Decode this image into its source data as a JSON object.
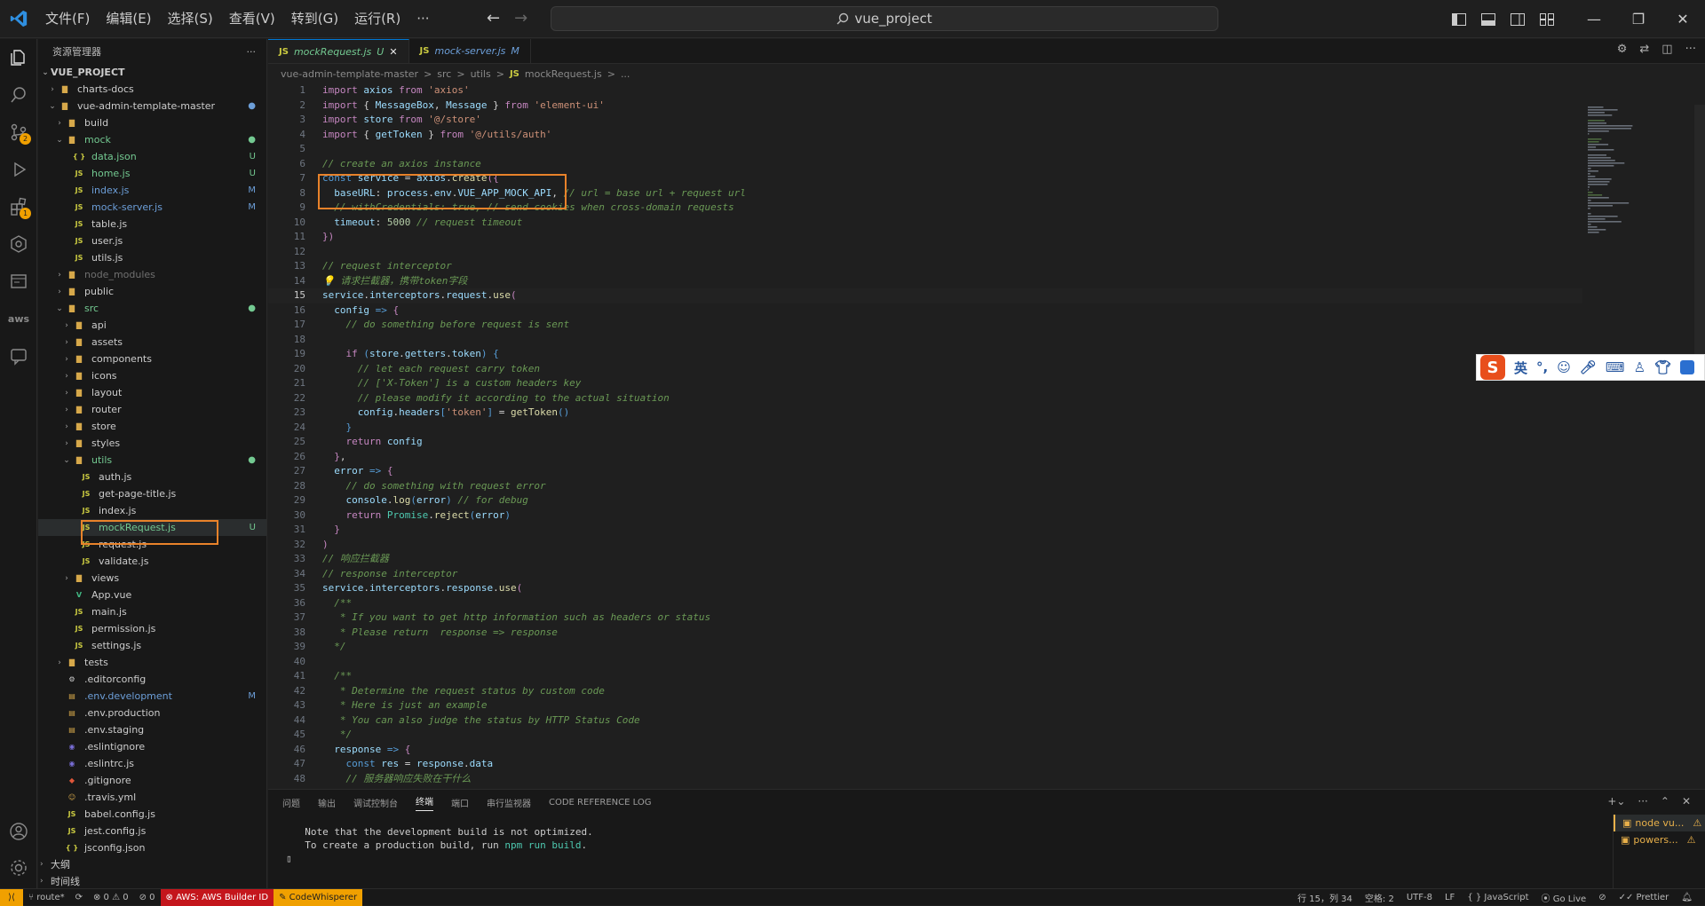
{
  "titlebar": {
    "menu": [
      "文件(F)",
      "编辑(E)",
      "选择(S)",
      "查看(V)",
      "转到(G)",
      "运行(R)",
      "···"
    ],
    "search_text": "vue_project"
  },
  "sidebar": {
    "header": "资源管理器",
    "project": "VUE_PROJECT",
    "outline": "大纲",
    "timeline": "时间线"
  },
  "tree": [
    {
      "name": "charts-docs",
      "indent": 1,
      "type": "folder",
      "open": false
    },
    {
      "name": "vue-admin-template-master",
      "indent": 1,
      "type": "folder",
      "open": true,
      "status": "●",
      "statusClass": "cM"
    },
    {
      "name": "build",
      "indent": 2,
      "type": "folder",
      "open": false
    },
    {
      "name": "mock",
      "indent": 2,
      "type": "folder",
      "open": true,
      "status": "●",
      "statusClass": "cU",
      "textClass": "cU"
    },
    {
      "name": "data.json",
      "indent": 3,
      "type": "json",
      "status": "U",
      "statusClass": "cU",
      "textClass": "cU"
    },
    {
      "name": "home.js",
      "indent": 3,
      "type": "js",
      "status": "U",
      "statusClass": "cU",
      "textClass": "cU"
    },
    {
      "name": "index.js",
      "indent": 3,
      "type": "js",
      "status": "M",
      "statusClass": "cM",
      "textClass": "cM"
    },
    {
      "name": "mock-server.js",
      "indent": 3,
      "type": "js",
      "status": "M",
      "statusClass": "cM",
      "textClass": "cM"
    },
    {
      "name": "table.js",
      "indent": 3,
      "type": "js"
    },
    {
      "name": "user.js",
      "indent": 3,
      "type": "js"
    },
    {
      "name": "utils.js",
      "indent": 3,
      "type": "js"
    },
    {
      "name": "node_modules",
      "indent": 2,
      "type": "folder",
      "open": false,
      "textClass": "cG"
    },
    {
      "name": "public",
      "indent": 2,
      "type": "folder",
      "open": false
    },
    {
      "name": "src",
      "indent": 2,
      "type": "folder",
      "open": true,
      "status": "●",
      "statusClass": "cU",
      "textClass": "cU"
    },
    {
      "name": "api",
      "indent": 3,
      "type": "folder",
      "open": false
    },
    {
      "name": "assets",
      "indent": 3,
      "type": "folder",
      "open": false
    },
    {
      "name": "components",
      "indent": 3,
      "type": "folder",
      "open": false
    },
    {
      "name": "icons",
      "indent": 3,
      "type": "folder",
      "open": false
    },
    {
      "name": "layout",
      "indent": 3,
      "type": "folder",
      "open": false
    },
    {
      "name": "router",
      "indent": 3,
      "type": "folder",
      "open": false
    },
    {
      "name": "store",
      "indent": 3,
      "type": "folder",
      "open": false
    },
    {
      "name": "styles",
      "indent": 3,
      "type": "folder",
      "open": false
    },
    {
      "name": "utils",
      "indent": 3,
      "type": "folder",
      "open": true,
      "status": "●",
      "statusClass": "cU",
      "textClass": "cU"
    },
    {
      "name": "auth.js",
      "indent": 4,
      "type": "js"
    },
    {
      "name": "get-page-title.js",
      "indent": 4,
      "type": "js"
    },
    {
      "name": "index.js",
      "indent": 4,
      "type": "js"
    },
    {
      "name": "mockRequest.js",
      "indent": 4,
      "type": "js",
      "status": "U",
      "statusClass": "cU",
      "textClass": "cU",
      "selected": true
    },
    {
      "name": "request.js",
      "indent": 4,
      "type": "js"
    },
    {
      "name": "validate.js",
      "indent": 4,
      "type": "js"
    },
    {
      "name": "views",
      "indent": 3,
      "type": "folder",
      "open": false
    },
    {
      "name": "App.vue",
      "indent": 3,
      "type": "vue"
    },
    {
      "name": "main.js",
      "indent": 3,
      "type": "js"
    },
    {
      "name": "permission.js",
      "indent": 3,
      "type": "js"
    },
    {
      "name": "settings.js",
      "indent": 3,
      "type": "js"
    },
    {
      "name": "tests",
      "indent": 2,
      "type": "folder",
      "open": false
    },
    {
      "name": ".editorconfig",
      "indent": 2,
      "type": "cfg"
    },
    {
      "name": ".env.development",
      "indent": 2,
      "type": "env",
      "status": "M",
      "statusClass": "cM",
      "textClass": "cM"
    },
    {
      "name": ".env.production",
      "indent": 2,
      "type": "env"
    },
    {
      "name": ".env.staging",
      "indent": 2,
      "type": "env"
    },
    {
      "name": ".eslintignore",
      "indent": 2,
      "type": "eslint"
    },
    {
      "name": ".eslintrc.js",
      "indent": 2,
      "type": "eslint"
    },
    {
      "name": ".gitignore",
      "indent": 2,
      "type": "git"
    },
    {
      "name": ".travis.yml",
      "indent": 2,
      "type": "travis"
    },
    {
      "name": "babel.config.js",
      "indent": 2,
      "type": "js"
    },
    {
      "name": "jest.config.js",
      "indent": 2,
      "type": "js"
    },
    {
      "name": "jsconfig.json",
      "indent": 2,
      "type": "json"
    }
  ],
  "tabs": [
    {
      "label": "mockRequest.js",
      "status": "U",
      "active": true
    },
    {
      "label": "mock-server.js",
      "status": "M",
      "active": false
    }
  ],
  "breadcrumb": [
    "vue-admin-template-master",
    ">",
    "src",
    ">",
    "utils",
    ">",
    "JS",
    "mockRequest.js",
    ">",
    "..."
  ],
  "code": [
    [
      [
        "kw",
        "import "
      ],
      [
        "vr",
        "axios "
      ],
      [
        "kw",
        "from "
      ],
      [
        "st2",
        "'axios'"
      ]
    ],
    [
      [
        "kw",
        "import "
      ],
      [
        "df",
        "{ "
      ],
      [
        "vr",
        "MessageBox"
      ],
      [
        "df",
        ", "
      ],
      [
        "vr",
        "Message "
      ],
      [
        "df",
        "} "
      ],
      [
        "kw",
        "from "
      ],
      [
        "st2",
        "'element-ui'"
      ]
    ],
    [
      [
        "kw",
        "import "
      ],
      [
        "vr",
        "store "
      ],
      [
        "kw",
        "from "
      ],
      [
        "st2",
        "'@/store'"
      ]
    ],
    [
      [
        "kw",
        "import "
      ],
      [
        "df",
        "{ "
      ],
      [
        "vr",
        "getToken "
      ],
      [
        "df",
        "} "
      ],
      [
        "kw",
        "from "
      ],
      [
        "st2",
        "'@/utils/auth'"
      ]
    ],
    [],
    [
      [
        "cm",
        "// create an axios instance"
      ]
    ],
    [
      [
        "bl",
        "const "
      ],
      [
        "vr",
        "service "
      ],
      [
        "df",
        "= "
      ],
      [
        "vr",
        "axios"
      ],
      [
        "df",
        "."
      ],
      [
        "fn",
        "create"
      ],
      [
        "kw",
        "({"
      ]
    ],
    [
      [
        "df",
        "  "
      ],
      [
        "vr",
        "baseURL"
      ],
      [
        "df",
        ": "
      ],
      [
        "vr",
        "process"
      ],
      [
        "df",
        "."
      ],
      [
        "vr",
        "env"
      ],
      [
        "df",
        "."
      ],
      [
        "vr",
        "VUE_APP_MOCK_API"
      ],
      [
        "df",
        ", "
      ],
      [
        "cm",
        "// url = base url + request url"
      ]
    ],
    [
      [
        "df",
        "  "
      ],
      [
        "cm",
        "// withCredentials: true, // send cookies when cross-domain requests"
      ]
    ],
    [
      [
        "df",
        "  "
      ],
      [
        "vr",
        "timeout"
      ],
      [
        "df",
        ": "
      ],
      [
        "nm",
        "5000 "
      ],
      [
        "cm",
        "// request timeout"
      ]
    ],
    [
      [
        "kw",
        "})"
      ]
    ],
    [],
    [
      [
        "cm",
        "// request interceptor"
      ]
    ],
    [
      [
        "cm",
        "💡 请求拦截器，携带token字段"
      ]
    ],
    [
      [
        "vr",
        "service"
      ],
      [
        "df",
        "."
      ],
      [
        "vr",
        "interceptors"
      ],
      [
        "df",
        "."
      ],
      [
        "vr",
        "request"
      ],
      [
        "df",
        "."
      ],
      [
        "fn",
        "use"
      ],
      [
        "kw",
        "("
      ]
    ],
    [
      [
        "df",
        "  "
      ],
      [
        "vr",
        "config "
      ],
      [
        "bl",
        "=> "
      ],
      [
        "kw",
        "{"
      ]
    ],
    [
      [
        "df",
        "    "
      ],
      [
        "cm",
        "// do something before request is sent"
      ]
    ],
    [],
    [
      [
        "df",
        "    "
      ],
      [
        "kw",
        "if "
      ],
      [
        "bl",
        "("
      ],
      [
        "vr",
        "store"
      ],
      [
        "df",
        "."
      ],
      [
        "vr",
        "getters"
      ],
      [
        "df",
        "."
      ],
      [
        "vr",
        "token"
      ],
      [
        "bl",
        ") "
      ],
      [
        "bl",
        "{"
      ]
    ],
    [
      [
        "df",
        "      "
      ],
      [
        "cm",
        "// let each request carry token"
      ]
    ],
    [
      [
        "df",
        "      "
      ],
      [
        "cm",
        "// ['X-Token'] is a custom headers key"
      ]
    ],
    [
      [
        "df",
        "      "
      ],
      [
        "cm",
        "// please modify it according to the actual situation"
      ]
    ],
    [
      [
        "df",
        "      "
      ],
      [
        "vr",
        "config"
      ],
      [
        "df",
        "."
      ],
      [
        "vr",
        "headers"
      ],
      [
        "bl",
        "["
      ],
      [
        "st2",
        "'token'"
      ],
      [
        "bl",
        "] "
      ],
      [
        "df",
        "= "
      ],
      [
        "fn",
        "getToken"
      ],
      [
        "bl",
        "()"
      ]
    ],
    [
      [
        "df",
        "    "
      ],
      [
        "bl",
        "}"
      ]
    ],
    [
      [
        "df",
        "    "
      ],
      [
        "kw",
        "return "
      ],
      [
        "vr",
        "config"
      ]
    ],
    [
      [
        "df",
        "  "
      ],
      [
        "kw",
        "}"
      ],
      [
        "df",
        ","
      ]
    ],
    [
      [
        "df",
        "  "
      ],
      [
        "vr",
        "error "
      ],
      [
        "bl",
        "=> "
      ],
      [
        "kw",
        "{"
      ]
    ],
    [
      [
        "df",
        "    "
      ],
      [
        "cm",
        "// do something with request error"
      ]
    ],
    [
      [
        "df",
        "    "
      ],
      [
        "vr",
        "console"
      ],
      [
        "df",
        "."
      ],
      [
        "fn",
        "log"
      ],
      [
        "bl",
        "("
      ],
      [
        "vr",
        "error"
      ],
      [
        "bl",
        ") "
      ],
      [
        "cm",
        "// for debug"
      ]
    ],
    [
      [
        "df",
        "    "
      ],
      [
        "kw",
        "return "
      ],
      [
        "cls",
        "Promise"
      ],
      [
        "df",
        "."
      ],
      [
        "fn",
        "reject"
      ],
      [
        "bl",
        "("
      ],
      [
        "vr",
        "error"
      ],
      [
        "bl",
        ")"
      ]
    ],
    [
      [
        "df",
        "  "
      ],
      [
        "kw",
        "}"
      ]
    ],
    [
      [
        "kw",
        ")"
      ]
    ],
    [
      [
        "cm",
        "// 响应拦截器"
      ]
    ],
    [
      [
        "cm",
        "// response interceptor"
      ]
    ],
    [
      [
        "vr",
        "service"
      ],
      [
        "df",
        "."
      ],
      [
        "vr",
        "interceptors"
      ],
      [
        "df",
        "."
      ],
      [
        "vr",
        "response"
      ],
      [
        "df",
        "."
      ],
      [
        "fn",
        "use"
      ],
      [
        "kw",
        "("
      ]
    ],
    [
      [
        "df",
        "  "
      ],
      [
        "cm",
        "/**"
      ]
    ],
    [
      [
        "df",
        "  "
      ],
      [
        "cm",
        " * If you want to get http information such as headers or status"
      ]
    ],
    [
      [
        "df",
        "  "
      ],
      [
        "cm",
        " * Please return  response => response"
      ]
    ],
    [
      [
        "df",
        "  "
      ],
      [
        "cm",
        "*/"
      ]
    ],
    [],
    [
      [
        "df",
        "  "
      ],
      [
        "cm",
        "/**"
      ]
    ],
    [
      [
        "df",
        "  "
      ],
      [
        "cm",
        " * Determine the request status by custom code"
      ]
    ],
    [
      [
        "df",
        "  "
      ],
      [
        "cm",
        " * Here is just an example"
      ]
    ],
    [
      [
        "df",
        "  "
      ],
      [
        "cm",
        " * You can also judge the status by HTTP Status Code"
      ]
    ],
    [
      [
        "df",
        "  "
      ],
      [
        "cm",
        " */"
      ]
    ],
    [
      [
        "df",
        "  "
      ],
      [
        "vr",
        "response "
      ],
      [
        "bl",
        "=> "
      ],
      [
        "kw",
        "{"
      ]
    ],
    [
      [
        "df",
        "    "
      ],
      [
        "bl",
        "const "
      ],
      [
        "vr",
        "res "
      ],
      [
        "df",
        "= "
      ],
      [
        "vr",
        "response"
      ],
      [
        "df",
        "."
      ],
      [
        "vr",
        "data"
      ]
    ],
    [
      [
        "df",
        "    "
      ],
      [
        "cm",
        "// 服务器响应失败在干什么"
      ]
    ]
  ],
  "current_line": 15,
  "panel": {
    "tabs": [
      "问题",
      "输出",
      "调试控制台",
      "终端",
      "端口",
      "串行监视器",
      "CODE REFERENCE LOG"
    ],
    "active_tab": "终端",
    "terminal_line1": "  Note that the development build is not optimized.",
    "terminal_line2a": "  To create a production build, run ",
    "terminal_cmd": "npm run build",
    "terminal_line2b": ".",
    "terminal_prompt": "▯",
    "terminals": [
      "node vu...",
      "powers..."
    ]
  },
  "ime": {
    "logo": "S",
    "mode": "英",
    "punct": "°,"
  },
  "status": {
    "branch": "route*",
    "sync": "⟳",
    "errors": "⊗ 0 ⚠ 0",
    "ports": "⊘ 0",
    "aws": "⊗ AWS: AWS Builder ID",
    "codewhisperer": "✎ CodeWhisperer",
    "cursor": "行 15，列 34",
    "spaces": "空格: 2",
    "encoding": "UTF-8",
    "eol": "LF",
    "language": "{ } JavaScript",
    "golive": "⦿ Go Live",
    "prettier": "✓✓ Prettier"
  },
  "colors": {
    "accent": "#0078d4",
    "highlight_box": "#e8822a",
    "untracked": "#73c991",
    "modified": "#6c9ed8"
  }
}
